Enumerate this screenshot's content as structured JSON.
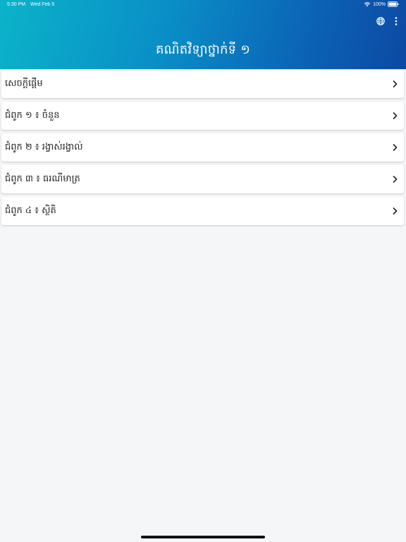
{
  "status_bar": {
    "time": "5:30 PM",
    "date": "Wed Feb 5",
    "battery": "100%"
  },
  "header": {
    "title": "គណិតវិទ្យាថ្នាក់ទី ១",
    "actions": [
      {
        "icon": "globe-icon"
      },
      {
        "icon": "more-vertical-icon"
      }
    ]
  },
  "menu": {
    "items": [
      {
        "label": "សេចក្តីផ្តើម"
      },
      {
        "label": "ជំពូក ១ ៖ ចំនួន"
      },
      {
        "label": "ជំពូក ២ ៖ រង្វាស់រង្វាល់"
      },
      {
        "label": "ជំពូក ៣ ៖ ធរណីមាត្រ"
      },
      {
        "label": "ជំពូក ៤ ៖ ស្ថិតិ"
      }
    ]
  },
  "colors": {
    "header_gradient_start": "#0bb3c9",
    "header_gradient_end": "#0c49a3",
    "background": "#f5f6f8",
    "card": "#ffffff",
    "text": "#222222"
  }
}
